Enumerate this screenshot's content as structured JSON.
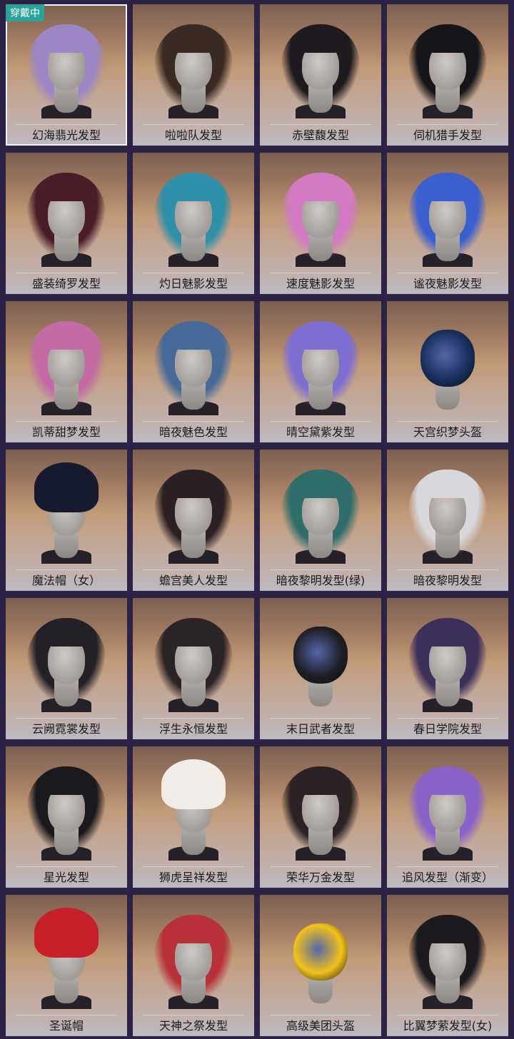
{
  "wearing_badge": "穿戴中",
  "items": [
    {
      "label": "幻海翡光发型",
      "hair": "#9c86c4",
      "style": "hair"
    },
    {
      "label": "啦啦队发型",
      "hair": "#3a2a24",
      "style": "hair"
    },
    {
      "label": "赤壁馥发型",
      "hair": "#1e1a20",
      "style": "hair"
    },
    {
      "label": "伺机猎手发型",
      "hair": "#16161a",
      "style": "hair"
    },
    {
      "label": "盛装绮罗发型",
      "hair": "#4a1c28",
      "style": "hair"
    },
    {
      "label": "灼日魅影发型",
      "hair": "#2e8fa8",
      "style": "hair"
    },
    {
      "label": "速度魅影发型",
      "hair": "#d47ac4",
      "style": "hair"
    },
    {
      "label": "谧夜魅影发型",
      "hair": "#3b5fcf",
      "style": "hair"
    },
    {
      "label": "凯蒂甜梦发型",
      "hair": "#c46aa4",
      "style": "hair"
    },
    {
      "label": "暗夜魅色发型",
      "hair": "#476a98",
      "style": "hair"
    },
    {
      "label": "晴空黛紫发型",
      "hair": "#7e6ed0",
      "style": "hair"
    },
    {
      "label": "天宫织梦头盔",
      "hair": "#18305e",
      "style": "helmet"
    },
    {
      "label": "魔法帽（女）",
      "hair": "#161a2e",
      "style": "hat"
    },
    {
      "label": "蟾宫美人发型",
      "hair": "#2a1f22",
      "style": "hair"
    },
    {
      "label": "暗夜黎明发型(绿)",
      "hair": "#2f6d6a",
      "style": "hair"
    },
    {
      "label": "暗夜黎明发型",
      "hair": "#d8d8dc",
      "style": "hair"
    },
    {
      "label": "云阙霓裳发型",
      "hair": "#232028",
      "style": "hair"
    },
    {
      "label": "浮生永恒发型",
      "hair": "#2b2426",
      "style": "hair"
    },
    {
      "label": "末日武者发型",
      "hair": "#1f1f26",
      "style": "helmet"
    },
    {
      "label": "春日学院发型",
      "hair": "#3c2f5a",
      "style": "hair"
    },
    {
      "label": "星光发型",
      "hair": "#1a1a1e",
      "style": "hair"
    },
    {
      "label": "狮虎呈祥发型",
      "hair": "#f1ece8",
      "style": "hat"
    },
    {
      "label": "荣华万金发型",
      "hair": "#2a2224",
      "style": "hair"
    },
    {
      "label": "追风发型（渐变）",
      "hair": "#8a63c9",
      "style": "hair"
    },
    {
      "label": "圣诞帽",
      "hair": "#c8202a",
      "style": "hat"
    },
    {
      "label": "天神之祭发型",
      "hair": "#b8303a",
      "style": "hair"
    },
    {
      "label": "高级美团头盔",
      "hair": "#f2c21a",
      "style": "helmet"
    },
    {
      "label": "比翼梦萦发型(女)",
      "hair": "#1c1a1e",
      "style": "hair"
    }
  ]
}
